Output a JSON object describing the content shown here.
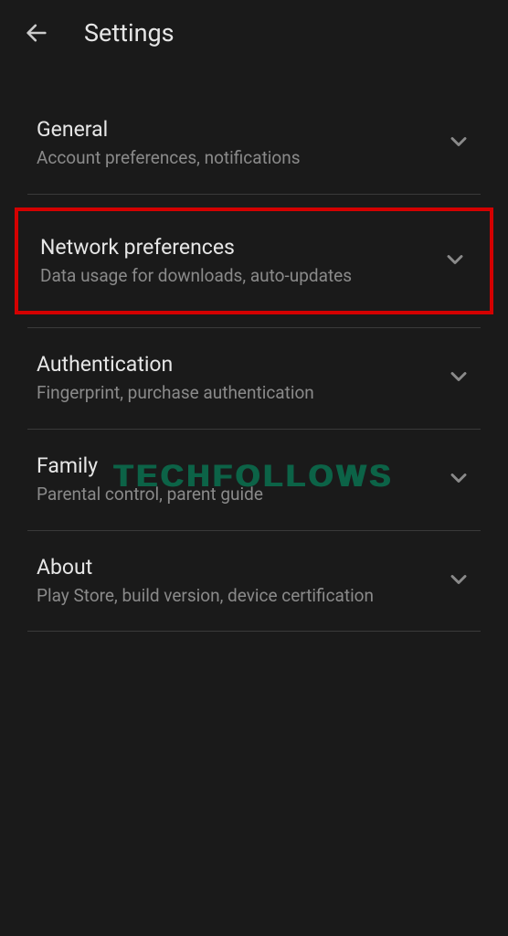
{
  "header": {
    "title": "Settings"
  },
  "items": [
    {
      "title": "General",
      "subtitle": "Account preferences, notifications"
    },
    {
      "title": "Network preferences",
      "subtitle": "Data usage for downloads, auto-updates"
    },
    {
      "title": "Authentication",
      "subtitle": "Fingerprint, purchase authentication"
    },
    {
      "title": "Family",
      "subtitle": "Parental control, parent guide"
    },
    {
      "title": "About",
      "subtitle": "Play Store, build version, device certification"
    }
  ],
  "watermark": "TECHFOLLOWS"
}
